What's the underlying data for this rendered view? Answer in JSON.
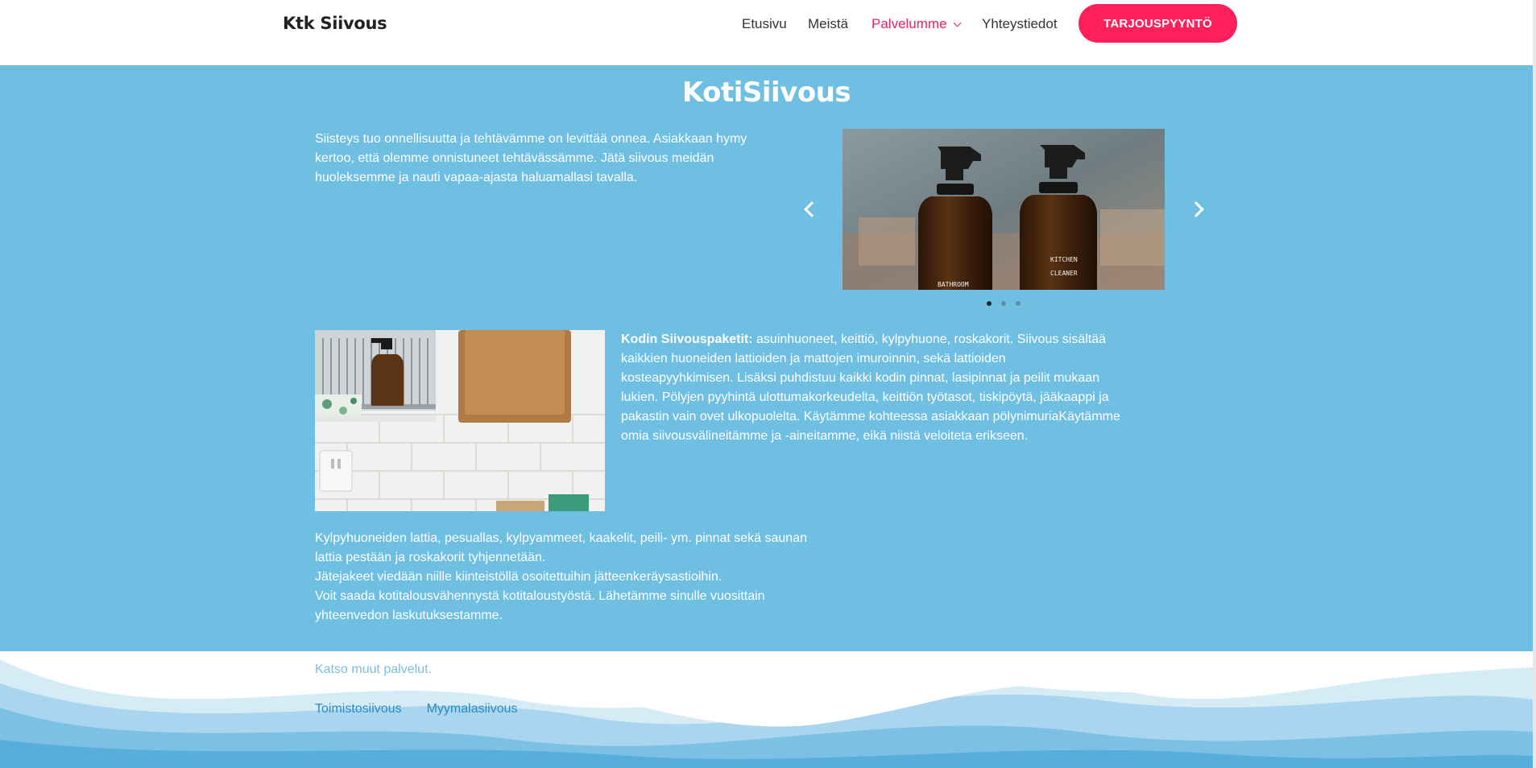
{
  "header": {
    "logo": "Ktk Siivous",
    "nav": [
      {
        "label": "Etusivu"
      },
      {
        "label": "Meistä"
      },
      {
        "label": "Palvelumme"
      },
      {
        "label": "Yhteystiedot"
      }
    ],
    "cta_label": "TARJOUSPYYNTÖ"
  },
  "main": {
    "title": "KotiSiivous",
    "intro": "Siisteys tuo onnellisuutta ja tehtävämme on levittää onnea. Asiakkaan hymy kertoo, että olemme onnistuneet tehtävässämme. Jätä siivous meidän huoleksemme ja nauti vapaa-ajasta haluamallasi tavalla.",
    "carousel": {
      "dots": 3,
      "active_dot": 1,
      "bottle_labels": [
        "BATHROOM",
        "KITCHEN",
        "CLEANER"
      ]
    },
    "package_label": "Kodin Siivouspaketit:",
    "package_text": " asuinhuoneet, keittiö, kylpyhuone, roskakorit. Siivous sisältää kaikkien huoneiden lattioiden ja mattojen imuroinnin, sekä lattioiden kosteapyyhkimisen. Lisäksi puhdistuu kaikki kodin pinnat, lasipinnat ja peilit mukaan lukien. Pölyjen pyyhintä ulottumakorkeudelta, keittiön työtasot, tiskipöytä, jääkaappi ja pakastin vain ovet ulkopuolelta. Käytämme kohteessa asiakkaan pölynimuriaKäytämme omia siivousvälineitämme ja -aineitamme, eikä niistä veloiteta erikseen.",
    "bottom_lines": [
      "Kylpyhuoneiden lattia, pesuallas, kylpyammeet, kaakelit, peili- ym. pinnat sekä saunan lattia pestään ja roskakorit tyhjennetään.",
      "Jätejakeet viedään niille kiinteistöllä osoitettuihin jätteenkeräysastioihin.",
      "Voit saada kotitalousvähennystä kotitaloustyöstä. Lähetämme sinulle vuosittain yhteenvedon laskutuksestamme."
    ]
  },
  "footer": {
    "see_more": "Katso muut palvelut.",
    "links": [
      "Toimistosiivous",
      "Myymalasiivous"
    ]
  },
  "colors": {
    "main_bg": "#6fbfe3",
    "accent": "#ff1f5a",
    "active_nav": "#e0245e",
    "link": "#2a8ac6"
  }
}
